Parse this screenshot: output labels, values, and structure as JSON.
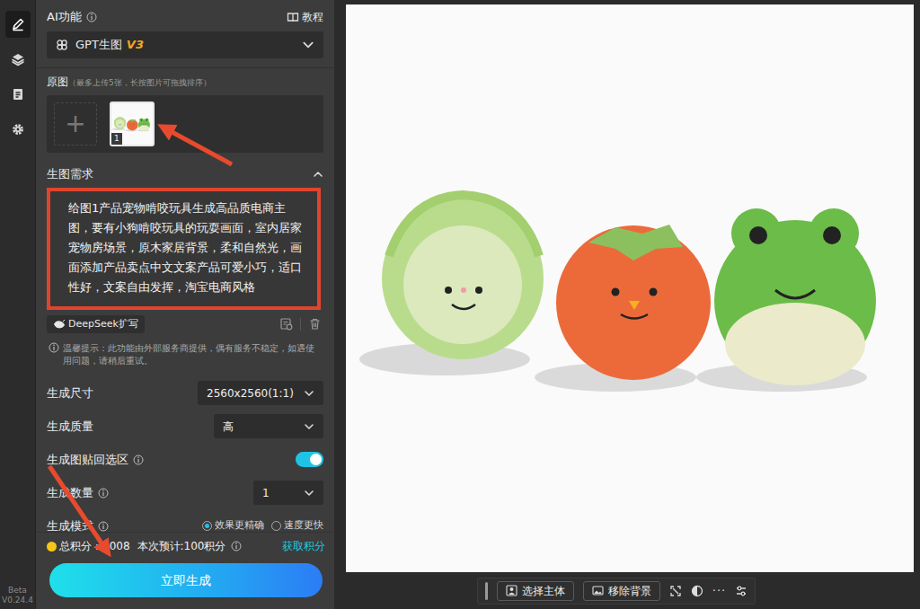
{
  "rail": {
    "items": [
      {
        "selected": true
      },
      {
        "selected": false
      },
      {
        "selected": false
      },
      {
        "selected": false
      }
    ],
    "version": [
      "Beta",
      "V0.24.4"
    ]
  },
  "panel": {
    "title": "AI功能",
    "tutorial": "教程"
  },
  "model": {
    "name": "GPT生图",
    "version": "V3"
  },
  "source": {
    "title": "原图",
    "hint": "（最多上传5张，长按图片可拖拽排序）",
    "add": "+",
    "images": [
      {
        "index": "1"
      }
    ]
  },
  "prompt": {
    "title": "生图需求",
    "expanded": true,
    "text": "给图1产品宠物啃咬玩具生成高品质电商主图，要有小狗啃咬玩具的玩耍画面，室内居家宠物房场景，原木家居背景，柔和自然光，画面添加产品卖点中文文案产品可爱小巧，适口性好，文案自由发挥，淘宝电商风格",
    "expand_button": "DeepSeek扩写"
  },
  "notice": "温馨提示：此功能由外部服务商提供，偶有服务不稳定，如遇使用问题，请稍后重试。",
  "settings": [
    {
      "kind": "select",
      "label": "生成尺寸",
      "info": false,
      "value": "2560x2560(1:1)"
    },
    {
      "kind": "select",
      "label": "生成质量",
      "info": false,
      "value": "高"
    },
    {
      "kind": "toggle",
      "label": "生成图贴回选区",
      "info": true,
      "on": true
    },
    {
      "kind": "select",
      "label": "生成数量",
      "info": true,
      "value": "1"
    },
    {
      "kind": "radio",
      "label": "生成模式",
      "info": true,
      "options": [
        {
          "label": "效果更精确",
          "selected": true
        },
        {
          "label": "速度更快",
          "selected": false
        }
      ]
    }
  ],
  "credits": {
    "label": "总积分：",
    "total": "7008",
    "estimate": "本次预计:100积分",
    "get": "获取积分"
  },
  "generate": "立即生成",
  "toolbar": {
    "buttons": [
      "选择主体",
      "移除背景"
    ],
    "more": "···"
  }
}
